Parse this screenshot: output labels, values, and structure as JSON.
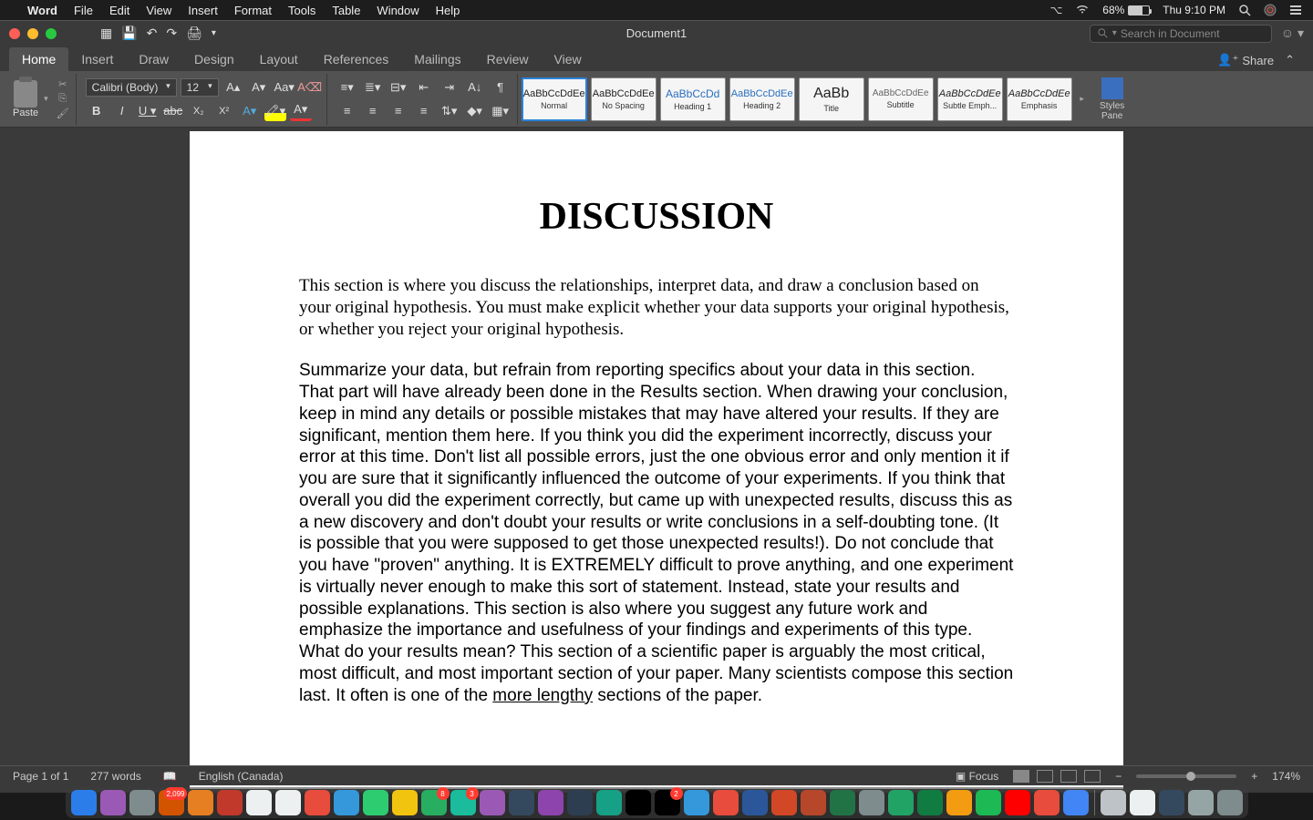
{
  "mac_menu": {
    "app": "Word",
    "items": [
      "File",
      "Edit",
      "View",
      "Insert",
      "Format",
      "Tools",
      "Table",
      "Window",
      "Help"
    ],
    "battery": "68%",
    "clock": "Thu 9:10 PM"
  },
  "titlebar": {
    "doc_title": "Document1",
    "search_placeholder": "Search in Document"
  },
  "ribbon_tabs": [
    "Home",
    "Insert",
    "Draw",
    "Design",
    "Layout",
    "References",
    "Mailings",
    "Review",
    "View"
  ],
  "share_label": "Share",
  "paste_label": "Paste",
  "font": {
    "name": "Calibri (Body)",
    "size": "12"
  },
  "styles": [
    {
      "preview": "AaBbCcDdEe",
      "label": "Normal",
      "cls": "",
      "sel": true
    },
    {
      "preview": "AaBbCcDdEe",
      "label": "No Spacing",
      "cls": ""
    },
    {
      "preview": "AaBbCcDd",
      "label": "Heading 1",
      "cls": "h1"
    },
    {
      "preview": "AaBbCcDdEe",
      "label": "Heading 2",
      "cls": "h2"
    },
    {
      "preview": "AaBb",
      "label": "Title",
      "cls": "title"
    },
    {
      "preview": "AaBbCcDdEe",
      "label": "Subtitle",
      "cls": "subtitle"
    },
    {
      "preview": "AaBbCcDdEe",
      "label": "Subtle Emph...",
      "cls": "emph"
    },
    {
      "preview": "AaBbCcDdEe",
      "label": "Emphasis",
      "cls": "emph"
    }
  ],
  "styles_pane_label": "Styles Pane",
  "document": {
    "heading": "DISCUSSION",
    "para1": "This section is where you discuss the relationships, interpret data, and draw a conclusion based on your original hypothesis. You must make explicit whether your data supports your original hypothesis, or whether you reject your original hypothesis.",
    "para2a": "Summarize your data, but refrain from reporting specifics about your data in this section. That part will have already been done in the Results section. When drawing your conclusion, keep in mind any details or possible mistakes that may have altered your results. If they are significant, mention them here. If you think you did the experiment incorrectly, discuss your error at this time. Don't list all possible errors, just the one obvious error and only mention it if you are sure that it significantly influenced the outcome of your experiments. If you think that overall you did the experiment correctly, but came up with unexpected results, discuss this as a new discovery and don't doubt your results or write conclusions in a self-doubting tone. (It is possible that you were supposed to get those unexpected results!). Do not conclude that you have \"proven\" anything. It is EXTREMELY difficult to prove anything, and one experiment is virtually never enough to make this sort of statement. Instead, state your results and possible explanations. This section is also where you suggest any future work and emphasize the importance and usefulness of your findings and experiments of this type. What do your results mean? This section of a scientific paper is arguably the most critical, most difficult, and most important section of your paper. Many scientists compose this section last. It often is one of the ",
    "para2_link": "more lengthy",
    "para2b": " sections of the paper."
  },
  "statusbar": {
    "page": "Page 1 of 1",
    "words": "277 words",
    "lang": "English (Canada)",
    "focus": "Focus",
    "zoom": "174%"
  },
  "dock_colors": [
    "#2b7de9",
    "#9b59b6",
    "#7f8c8d",
    "#d35400",
    "#e67e22",
    "#c0392b",
    "#ecf0f1",
    "#ecf0f1",
    "#e74c3c",
    "#3498db",
    "#2ecc71",
    "#f1c40f",
    "#27ae60",
    "#1abc9c",
    "#9b59b6",
    "#34495e",
    "#8e44ad",
    "#2c3e50",
    "#16a085",
    "#000000",
    "#000000",
    "#3498db",
    "#e74c3c",
    "#2b579a",
    "#d24726",
    "#b7472a",
    "#217346",
    "#7f8c8d",
    "#21a366",
    "#107c41",
    "#f39c12",
    "#1db954",
    "#ff0000",
    "#e74c3c",
    "#4285f4"
  ],
  "dock_right_colors": [
    "#bdc3c7",
    "#ecf0f1",
    "#34495e",
    "#95a5a6",
    "#7f8c8d"
  ],
  "dock_badges": {
    "3": "2,099",
    "12": "8",
    "13": "3",
    "20": "2"
  }
}
